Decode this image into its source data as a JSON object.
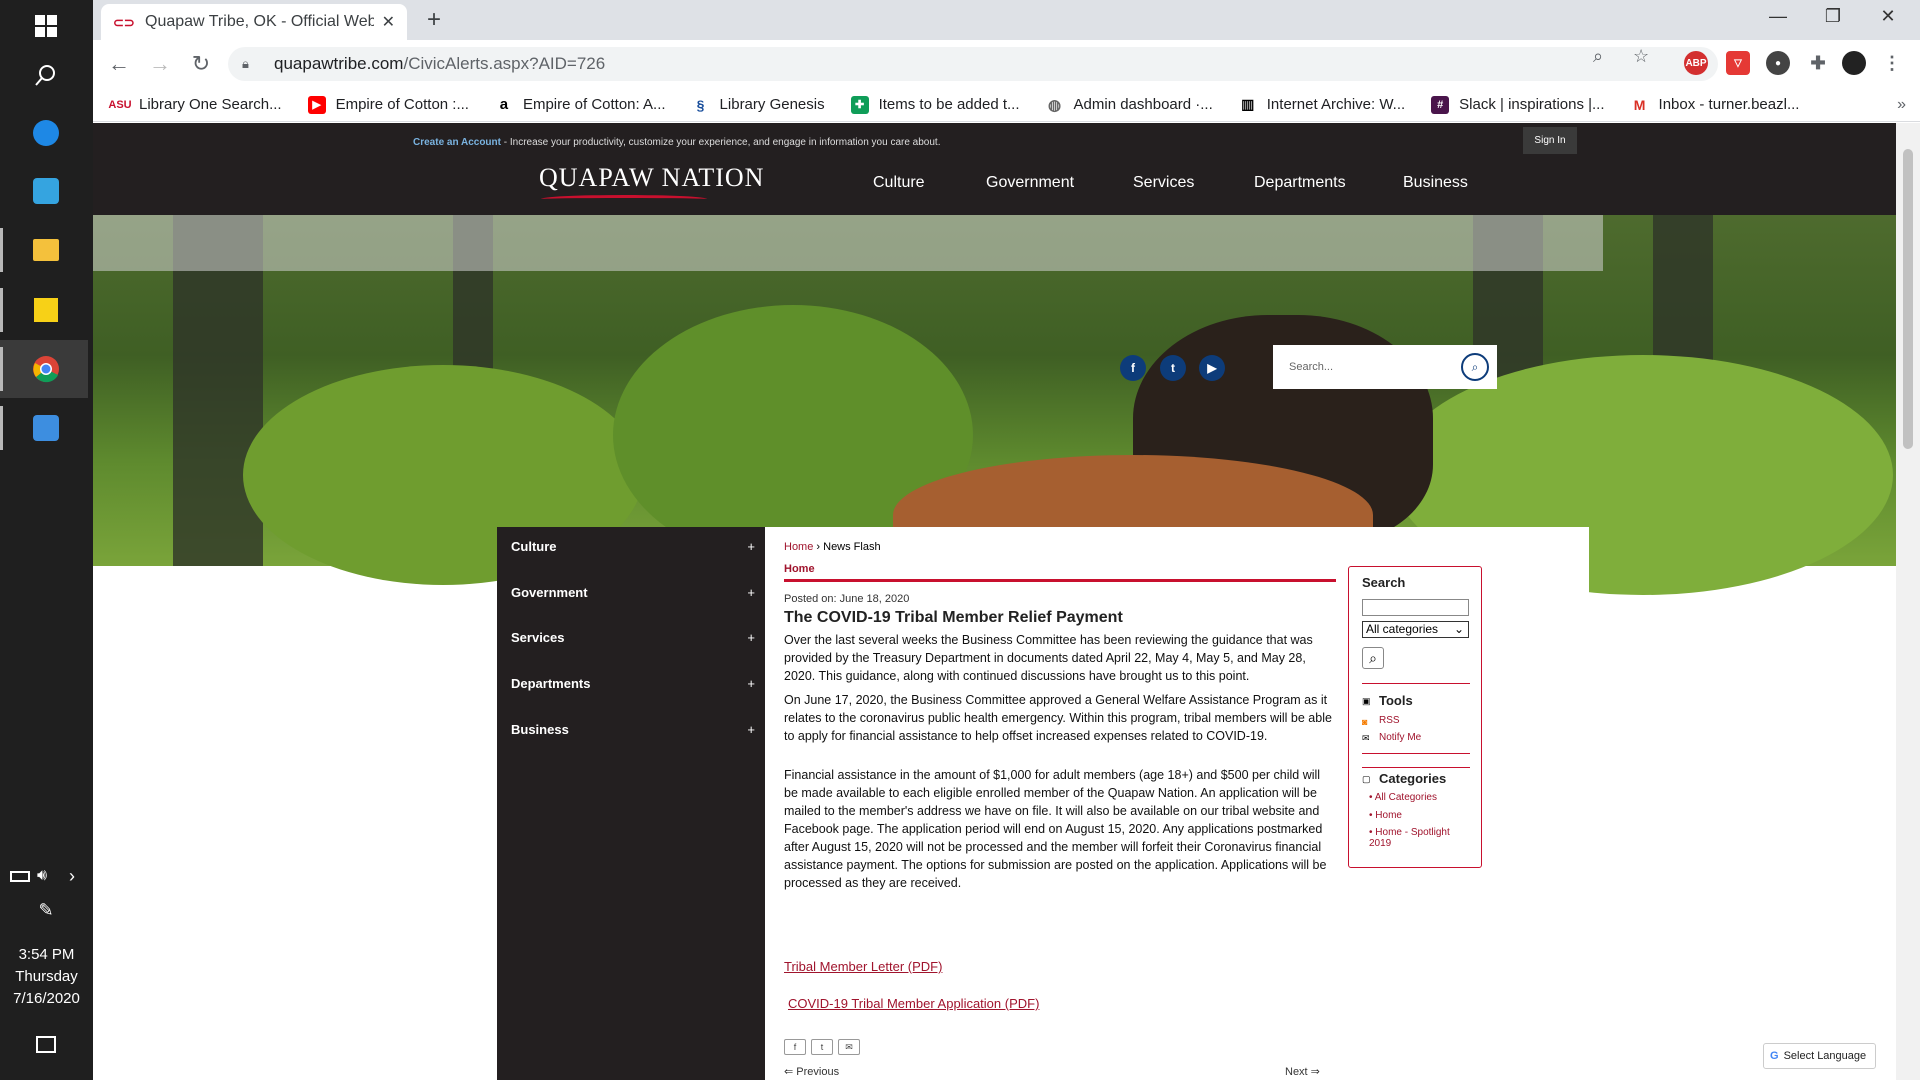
{
  "taskbar": {
    "time": "3:54 PM",
    "day": "Thursday",
    "date": "7/16/2020"
  },
  "browser": {
    "tab_title": "Quapaw Tribe, OK - Official Webs",
    "url_domain": "quapawtribe.com",
    "url_path": "/CivicAlerts.aspx?AID=726",
    "bookmarks": [
      "Library One Search...",
      "Empire of Cotton :...",
      "Empire of Cotton: A...",
      "Library Genesis",
      "Items to be added t...",
      "Admin dashboard ·...",
      "Internet Archive: W...",
      "Slack | inspirations |...",
      "Inbox - turner.beazl..."
    ],
    "ext_abp": "ABP"
  },
  "site": {
    "create_account": "Create an Account",
    "account_tagline": " - Increase your productivity, customize your experience, and engage in information you care about.",
    "sign_in": "Sign In",
    "logo": "QUAPAW NATION",
    "main_nav": [
      "Culture",
      "Government",
      "Services",
      "Departments",
      "Business"
    ],
    "search_placeholder": "Search...",
    "left_nav": [
      "Culture",
      "Government",
      "Services",
      "Departments",
      "Business"
    ],
    "select_language": "Select Language"
  },
  "article": {
    "crumb_home": "Home",
    "crumb_sep": " › ",
    "crumb_current": "News Flash",
    "section": "Home",
    "posted": "Posted on: June 18, 2020",
    "title": "The COVID-19 Tribal Member Relief Payment",
    "p1": "Over the last several weeks the Business Committee has been reviewing the guidance that was provided by the Treasury Department in documents dated April 22, May 4, May 5, and May 28, 2020. This guidance, along with continued discussions have brought us to this point.",
    "p2": "On June 17, 2020, the Business Committee approved a General Welfare Assistance Program as it relates to the coronavirus public health emergency. Within this program, tribal members will be able to apply for financial assistance to help offset increased expenses related to COVID-19.",
    "p3": "Financial assistance in the amount of $1,000 for adult members (age 18+) and $500 per child will be made available to each eligible enrolled member of the Quapaw Nation. An application will be mailed to the member's address we have on file. It will also be available on our tribal website and Facebook page. The application period will end on August 15, 2020. Any applications postmarked after August 15, 2020 will not be processed and the member will forfeit their Coronavirus financial assistance payment. The options for submission are posted on the application. Applications will be processed as they are received.",
    "link1": "Tribal Member Letter (PDF)",
    "link2": "COVID-19 Tribal Member Application (PDF)",
    "prev": "Previous",
    "next": "Next"
  },
  "sidebar": {
    "search_heading": "Search",
    "category_select": "All categories",
    "tools_heading": "Tools",
    "rss": "RSS",
    "notify": "Notify Me",
    "categories_heading": "Categories",
    "categories": [
      "All Categories",
      "Home",
      "Home - Spotlight 2019"
    ]
  },
  "colors": {
    "brand_red": "#c8102e",
    "nav_dark": "#231f20",
    "social_blue": "#0d3c7a"
  }
}
